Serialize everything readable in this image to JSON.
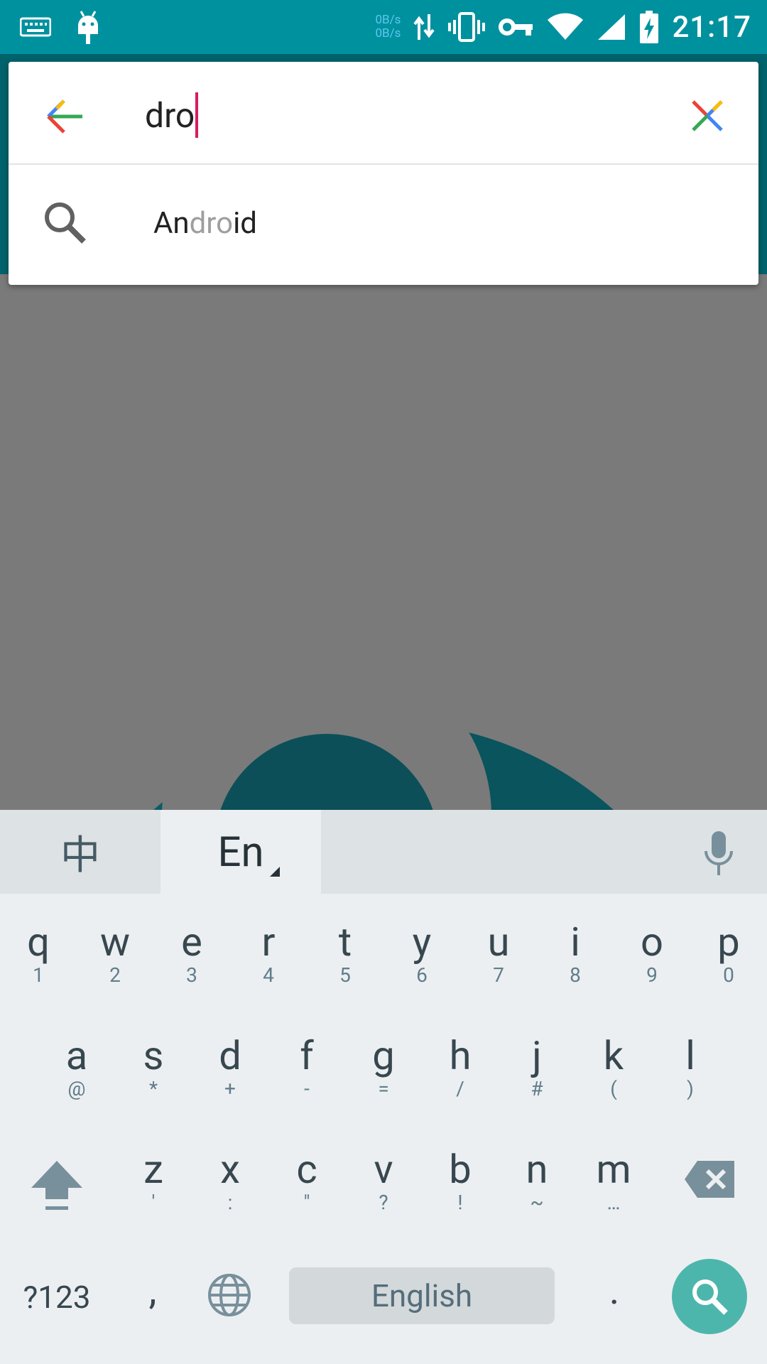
{
  "status_bar": {
    "time": "21:17",
    "net_up": "0B/s",
    "net_down": "0B/s",
    "icons": [
      "keyboard-icon",
      "android-debug-icon",
      "data-transfer-icon",
      "vibrate-icon",
      "vpn-key-icon",
      "wifi-icon",
      "signal-icon",
      "battery-charging-icon"
    ]
  },
  "search": {
    "query": "dro",
    "back_icon": "arrow-back-icon",
    "clear_icon": "close-icon",
    "suggestions": [
      {
        "icon": "search-icon",
        "prefix": "An",
        "match": "dro",
        "suffix": "id"
      }
    ]
  },
  "keyboard": {
    "lang_zh": "中",
    "lang_en": "En",
    "mic_icon": "mic-icon",
    "row1": [
      {
        "k": "q",
        "s": "1"
      },
      {
        "k": "w",
        "s": "2"
      },
      {
        "k": "e",
        "s": "3"
      },
      {
        "k": "r",
        "s": "4"
      },
      {
        "k": "t",
        "s": "5"
      },
      {
        "k": "y",
        "s": "6"
      },
      {
        "k": "u",
        "s": "7"
      },
      {
        "k": "i",
        "s": "8"
      },
      {
        "k": "o",
        "s": "9"
      },
      {
        "k": "p",
        "s": "0"
      }
    ],
    "row2": [
      {
        "k": "a",
        "s": "@"
      },
      {
        "k": "s",
        "s": "*"
      },
      {
        "k": "d",
        "s": "+"
      },
      {
        "k": "f",
        "s": "-"
      },
      {
        "k": "g",
        "s": "="
      },
      {
        "k": "h",
        "s": "/"
      },
      {
        "k": "j",
        "s": "#"
      },
      {
        "k": "k",
        "s": "("
      },
      {
        "k": "l",
        "s": ")"
      }
    ],
    "row3": [
      {
        "k": "z",
        "s": "'"
      },
      {
        "k": "x",
        "s": ":"
      },
      {
        "k": "c",
        "s": "\""
      },
      {
        "k": "v",
        "s": "?"
      },
      {
        "k": "b",
        "s": "!"
      },
      {
        "k": "n",
        "s": "~"
      },
      {
        "k": "m",
        "s": "…"
      }
    ],
    "symbols_key": "?123",
    "comma_key": ",",
    "globe_icon": "globe-icon",
    "space_label": "English",
    "period_key": ".",
    "shift_icon": "shift-icon",
    "backspace_icon": "backspace-icon",
    "enter_icon": "search-icon"
  },
  "colors": {
    "status_bar": "#00919f",
    "app_bar": "#00626b",
    "caret": "#d81b60",
    "search_key": "#4db6ac",
    "wallpaper_teal": "#0a5c66"
  }
}
